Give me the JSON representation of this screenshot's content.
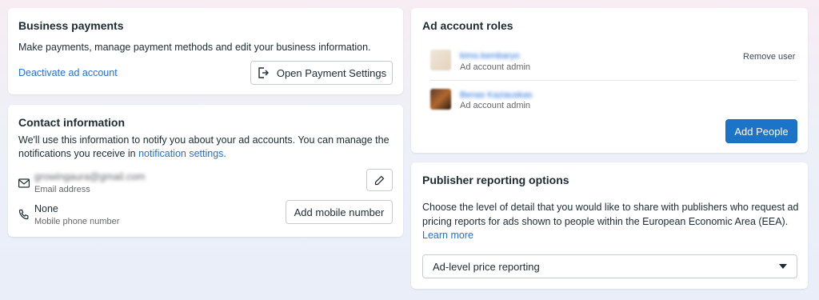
{
  "business_payments": {
    "title": "Business payments",
    "description": "Make payments, manage payment methods and edit your business information.",
    "deactivate_link": "Deactivate ad account",
    "open_settings_button": "Open Payment Settings"
  },
  "contact": {
    "title": "Contact information",
    "description_1": "We'll use this information to notify you about your ad accounts. You can manage the",
    "description_2": "notifications you receive in",
    "settings_link": "notification settings.",
    "email_value": "growingaura@gmail.com",
    "email_label": "Email address",
    "phone_value": "None",
    "phone_label": "Mobile phone number",
    "add_mobile_button": "Add mobile number"
  },
  "roles": {
    "title": "Ad account roles",
    "users": [
      {
        "name": "kimo.kembaryo",
        "role": "Ad account admin"
      },
      {
        "name": "Benas Kaziauskas",
        "role": "Ad account admin"
      }
    ],
    "remove_user": "Remove user",
    "add_people_button": "Add People",
    "accent": "#1b74c7"
  },
  "publisher": {
    "title": "Publisher reporting options",
    "description_1": "Choose the level of detail that you would like to share with publishers who request ad",
    "description_2": "pricing reports for ads shown to people within the European Economic Area (EEA).",
    "learn_more": "Learn more",
    "select_value": "Ad-level price reporting"
  }
}
